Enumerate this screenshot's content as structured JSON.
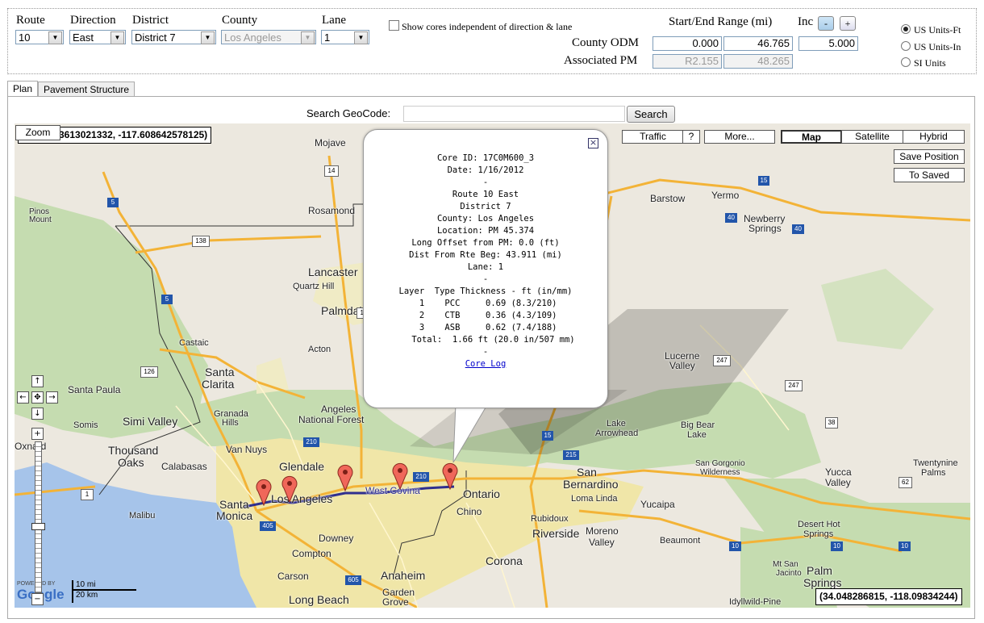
{
  "filters": {
    "route": {
      "label": "Route",
      "value": "10"
    },
    "direction": {
      "label": "Direction",
      "value": "East"
    },
    "district": {
      "label": "District",
      "value": "District 7"
    },
    "county": {
      "label": "County",
      "value": "Los Angeles"
    },
    "lane": {
      "label": "Lane",
      "value": "1"
    },
    "independent_checkbox": "Show cores independent of direction & lane"
  },
  "range": {
    "header": "Start/End Range (mi)",
    "inc_label": "Inc",
    "minus": "-",
    "plus": "+",
    "county_odm_label": "County ODM",
    "start": "0.000",
    "end": "46.765",
    "inc": "5.000",
    "assoc_pm_label": "Associated PM",
    "pm_start": "R2.155",
    "pm_end": "48.265"
  },
  "units": {
    "selected": "US Units-Ft",
    "options": [
      "US Units-Ft",
      "US Units-In",
      "SI Units"
    ]
  },
  "tabs": [
    "Plan",
    "Pavement Structure"
  ],
  "search": {
    "label": "Search GeoCode:",
    "value": "",
    "button": "Search"
  },
  "map": {
    "zoom_label": "Zoom",
    "coord_top": "3613021332, -117.608642578125)",
    "coord_bottom": "(34.048286815, -118.09834244)",
    "traffic": "Traffic",
    "help": "?",
    "more": "More...",
    "types": [
      "Map",
      "Satellite",
      "Hybrid"
    ],
    "save_position": "Save Position",
    "to_saved": "To Saved",
    "scale_mi": "10 mi",
    "scale_km": "20 km",
    "powered_by": "POWERED BY",
    "google": "Google",
    "nav": {
      "up": "↑",
      "down": "↓",
      "left": "←",
      "right": "→",
      "center": "✥",
      "zoom_in": "+",
      "zoom_out": "−"
    },
    "towns": [
      {
        "name": "Mojave"
      },
      {
        "name": "Rosamond"
      },
      {
        "name": "Barstow"
      },
      {
        "name": "Yermo"
      },
      {
        "name": "Newberry"
      },
      {
        "name": "Springs"
      },
      {
        "name": "Pinos"
      },
      {
        "name": "Mount"
      },
      {
        "name": "Lancaster"
      },
      {
        "name": "Quartz Hill"
      },
      {
        "name": "Palmdale"
      },
      {
        "name": "Castaic"
      },
      {
        "name": "Acton"
      },
      {
        "name": "Lucerne"
      },
      {
        "name": "Valley"
      },
      {
        "name": "Santa"
      },
      {
        "name": "Clarita"
      },
      {
        "name": "Santa Paula"
      },
      {
        "name": "Simi Valley"
      },
      {
        "name": "Granada"
      },
      {
        "name": "Hills"
      },
      {
        "name": "Angeles"
      },
      {
        "name": "National Forest"
      },
      {
        "name": "Somis"
      },
      {
        "name": "Lake"
      },
      {
        "name": "Arrowhead"
      },
      {
        "name": "Big Bear"
      },
      {
        "name": "Lake"
      },
      {
        "name": "Oxnard"
      },
      {
        "name": "Thousand"
      },
      {
        "name": "Oaks"
      },
      {
        "name": "Calabasas"
      },
      {
        "name": "Van Nuys"
      },
      {
        "name": "Glendale"
      },
      {
        "name": "San"
      },
      {
        "name": "Bernardino"
      },
      {
        "name": "San Gorgonio"
      },
      {
        "name": "Wilderness"
      },
      {
        "name": "Yucca"
      },
      {
        "name": "Valley"
      },
      {
        "name": "Twentynine"
      },
      {
        "name": "Palms"
      },
      {
        "name": "Santa"
      },
      {
        "name": "Monica"
      },
      {
        "name": "Malibu"
      },
      {
        "name": "Los Angeles"
      },
      {
        "name": "West Covina"
      },
      {
        "name": "Ontario"
      },
      {
        "name": "Chino"
      },
      {
        "name": "Loma Linda"
      },
      {
        "name": "Yucaipa"
      },
      {
        "name": "Rubidoux"
      },
      {
        "name": "Riverside"
      },
      {
        "name": "Moreno"
      },
      {
        "name": "Valley"
      },
      {
        "name": "Desert Hot"
      },
      {
        "name": "Springs"
      },
      {
        "name": "Beaumont"
      },
      {
        "name": "Downey"
      },
      {
        "name": "Compton"
      },
      {
        "name": "Corona"
      },
      {
        "name": "Carson"
      },
      {
        "name": "Anaheim"
      },
      {
        "name": "Garden"
      },
      {
        "name": "Grove"
      },
      {
        "name": "Long Beach"
      },
      {
        "name": "Mt San"
      },
      {
        "name": "Jacinto"
      },
      {
        "name": "Palm"
      },
      {
        "name": "Springs"
      },
      {
        "name": "Idyllwild-Pine"
      }
    ],
    "shields": [
      "5",
      "14",
      "15",
      "138",
      "40",
      "40",
      "5",
      "14",
      "126",
      "247",
      "247",
      "1",
      "210",
      "15",
      "215",
      "38",
      "210",
      "405",
      "605",
      "10",
      "10",
      "10",
      "62"
    ]
  },
  "popup": {
    "close": "×",
    "lines": [
      "Core ID: 17C0M600_3",
      "Date: 1/16/2012",
      "-",
      "Route 10 East",
      "District 7",
      "County: Los Angeles",
      "Location: PM 45.374",
      "Long Offset from PM: 0.0 (ft)",
      "Dist From Rte Beg: 43.911 (mi)",
      "Lane: 1",
      "-",
      "Layer  Type Thickness - ft (in/mm)",
      "  1    PCC     0.69 (8.3/210) ",
      "  2    CTB     0.36 (4.3/109) ",
      "  3    ASB     0.62 (7.4/188) ",
      "   Total:  1.66 ft (20.0 in/507 mm)",
      "-"
    ],
    "link": "Core Log"
  }
}
